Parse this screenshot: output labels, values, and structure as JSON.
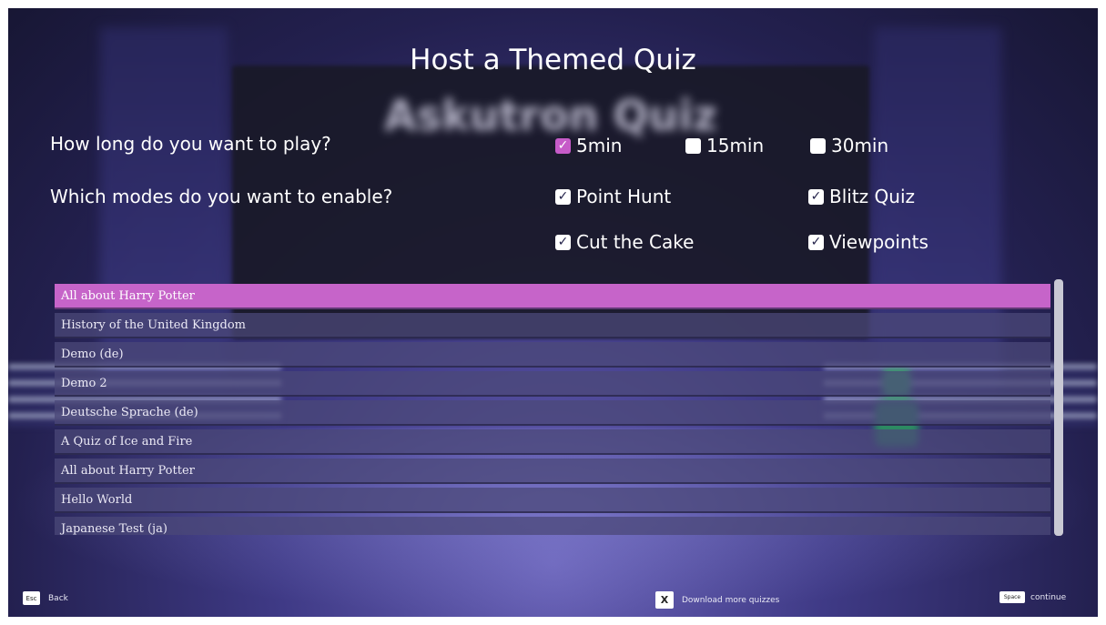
{
  "title": "Host a Themed Quiz",
  "background_board_title": "Askutron Quiz",
  "duration": {
    "label": "How long do you want to play?",
    "options": [
      {
        "label": "5min",
        "checked": true,
        "highlight": true
      },
      {
        "label": "15min",
        "checked": false
      },
      {
        "label": "30min",
        "checked": false
      }
    ]
  },
  "modes": {
    "label": "Which modes do you want to enable?",
    "options": [
      {
        "label": "Point Hunt",
        "checked": true
      },
      {
        "label": "Blitz Quiz",
        "checked": true
      },
      {
        "label": "Cut the Cake",
        "checked": true
      },
      {
        "label": "Viewpoints",
        "checked": true
      }
    ]
  },
  "quiz_list": [
    {
      "label": "All about Harry Potter",
      "selected": true
    },
    {
      "label": "History of the United Kingdom"
    },
    {
      "label": "Demo (de)"
    },
    {
      "label": "Demo 2"
    },
    {
      "label": "Deutsche Sprache (de)"
    },
    {
      "label": "A Quiz of Ice and Fire"
    },
    {
      "label": "All about Harry Potter"
    },
    {
      "label": "Hello World"
    },
    {
      "label": "Japanese Test (ja)"
    }
  ],
  "footer": {
    "back": {
      "key": "Esc",
      "label": "Back"
    },
    "download": {
      "key": "X",
      "label": "Download more quizzes"
    },
    "continue": {
      "key": "Space",
      "label": "continue"
    }
  },
  "colors": {
    "accent": "#c664c9",
    "row": "#4b4878"
  }
}
